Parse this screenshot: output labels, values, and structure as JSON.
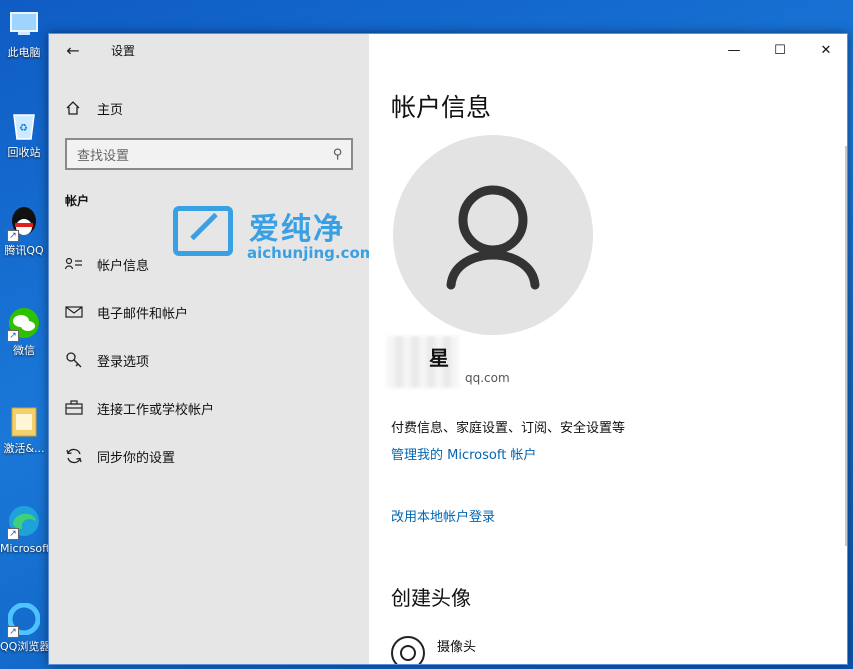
{
  "desktop": {
    "icons": [
      {
        "label": "此电脑",
        "icon": "computer-icon"
      },
      {
        "label": "回收站",
        "icon": "recycle-bin-icon"
      },
      {
        "label": "腾讯QQ",
        "icon": "qq-icon"
      },
      {
        "label": "微信",
        "icon": "wechat-icon"
      },
      {
        "label": "激活&...",
        "icon": "folder-icon"
      },
      {
        "label": "Microsoft Edge",
        "icon": "edge-icon"
      },
      {
        "label": "QQ浏览器",
        "icon": "qq-browser-icon"
      }
    ]
  },
  "window": {
    "app_title": "设置",
    "caption": {
      "minimize": "—",
      "maximize": "☐",
      "close": "✕"
    }
  },
  "sidebar": {
    "home_label": "主页",
    "search_placeholder": "查找设置",
    "section_title": "帐户",
    "items": [
      {
        "label": "帐户信息",
        "icon": "account-info-icon"
      },
      {
        "label": "电子邮件和帐户",
        "icon": "mail-icon"
      },
      {
        "label": "登录选项",
        "icon": "key-icon"
      },
      {
        "label": "连接工作或学校帐户",
        "icon": "briefcase-icon"
      },
      {
        "label": "同步你的设置",
        "icon": "sync-icon"
      }
    ]
  },
  "watermark": {
    "cn": "爱纯净",
    "en": "aichunjing.com"
  },
  "main": {
    "page_title": "帐户信息",
    "user_name": "星",
    "user_email": "qq.com",
    "billing_text": "付费信息、家庭设置、订阅、安全设置等",
    "manage_link": "管理我的 Microsoft 帐户",
    "local_login_link": "改用本地帐户登录",
    "create_avatar_title": "创建头像",
    "camera_label": "摄像头"
  },
  "colors": {
    "accent": "#0066b4",
    "sidebar_bg": "#e6e6e6",
    "desktop_bg": "#1a78d8"
  }
}
